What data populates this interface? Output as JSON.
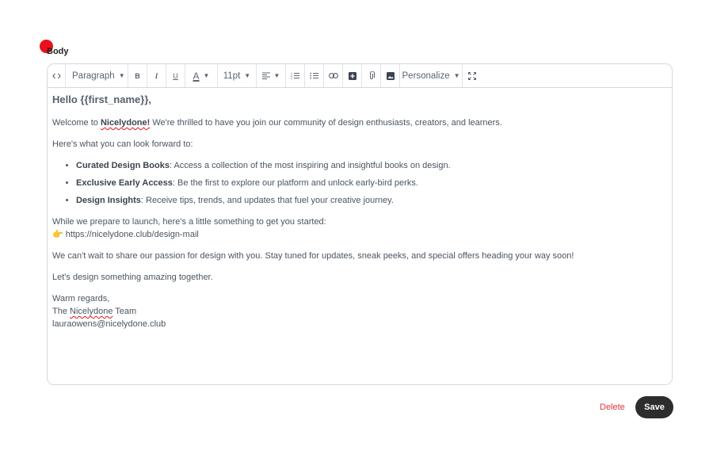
{
  "field": {
    "label": "Body"
  },
  "toolbar": {
    "block_style": "Paragraph",
    "bold_label": "B",
    "italic_label": "I",
    "underline_label": "U",
    "text_color_label": "A",
    "font_size": "11pt",
    "personalize_label": "Personalize",
    "icons": [
      "code-icon",
      "bold-icon",
      "italic-icon",
      "underline-icon",
      "text-color-icon",
      "align-icon",
      "ordered-list-icon",
      "bullet-list-icon",
      "link-icon",
      "add-block-icon",
      "attachment-icon",
      "image-icon",
      "fullscreen-icon"
    ]
  },
  "content": {
    "greeting": "Hello {{first_name}},",
    "welcome_pre": "Welcome to ",
    "welcome_brand": "Nicelydone!",
    "welcome_post": " We're thrilled to have you join our community of design enthusiasts, creators, and learners.",
    "lookforward": "Here's what you can look forward to:",
    "bullets": [
      {
        "title": "Curated Design Books",
        "text": ": Access a collection of the most inspiring and insightful books on design."
      },
      {
        "title": "Exclusive Early Access",
        "text": ": Be the first to explore our platform and unlock early-bird perks."
      },
      {
        "title": "Design Insights",
        "text": ": Receive tips, trends, and updates that fuel your creative journey."
      }
    ],
    "prepare": "While we prepare to launch, here's a little something to get you started:",
    "pointer_emoji": "👉",
    "url": "https://nicelydone.club/design-mail",
    "share": "We can't wait to share our passion for design with you. Stay tuned for updates, sneak peeks, and special offers heading your way soon!",
    "together": "Let's design something amazing together.",
    "signoff": "Warm regards,",
    "team_pre": "The ",
    "team_brand": "Nicelydone",
    "team_post": " Team",
    "email": "lauraowens@nicelydone.club"
  },
  "actions": {
    "delete_label": "Delete",
    "save_label": "Save"
  },
  "colors": {
    "delete": "#e0353b",
    "save_bg": "#2d2d2d",
    "cursor_dot": "#e8101a"
  }
}
